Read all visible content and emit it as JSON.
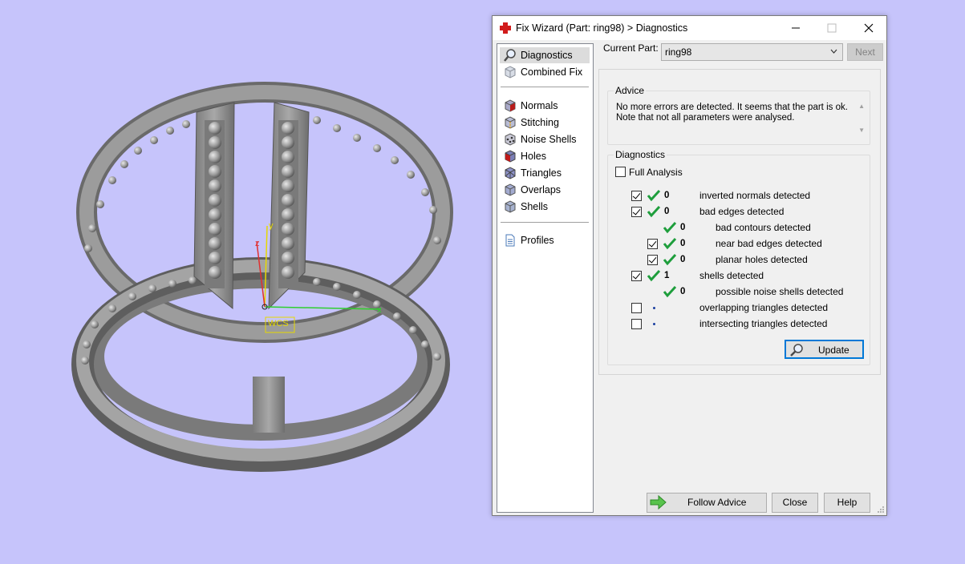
{
  "window": {
    "title": "Fix Wizard (Part: ring98) > Diagnostics"
  },
  "viewport": {
    "axis_x": "x",
    "axis_y": "y",
    "axis_z": "z",
    "wcs_label": "WCS"
  },
  "sidebar": {
    "items": [
      {
        "label": "Diagnostics",
        "icon": "magnifier-icon"
      },
      {
        "label": "Combined Fix",
        "icon": "combined-fix-icon"
      },
      {
        "label": "Normals",
        "icon": "normals-cube-icon"
      },
      {
        "label": "Stitching",
        "icon": "stitching-cube-icon"
      },
      {
        "label": "Noise Shells",
        "icon": "noise-shells-icon"
      },
      {
        "label": "Holes",
        "icon": "holes-cube-icon"
      },
      {
        "label": "Triangles",
        "icon": "triangles-cube-icon"
      },
      {
        "label": "Overlaps",
        "icon": "overlaps-cube-icon"
      },
      {
        "label": "Shells",
        "icon": "shells-cube-icon"
      },
      {
        "label": "Profiles",
        "icon": "document-icon"
      }
    ]
  },
  "current_part": {
    "label": "Current Part:",
    "value": "ring98",
    "next_label": "Next"
  },
  "advice": {
    "title": "Advice",
    "line1": "No more errors are detected. It seems that the part is ok.",
    "line2": "Note that not all parameters were analysed."
  },
  "diagnostics": {
    "title": "Diagnostics",
    "full_analysis_label": "Full Analysis",
    "rows": [
      {
        "checkbox": true,
        "checked": true,
        "status": "ok",
        "count": "0",
        "label": "inverted normals detected"
      },
      {
        "checkbox": true,
        "checked": true,
        "status": "ok",
        "count": "0",
        "label": "bad edges detected"
      },
      {
        "checkbox": false,
        "checked": false,
        "status": "ok",
        "count": "0",
        "label": "bad contours detected"
      },
      {
        "checkbox": true,
        "checked": true,
        "status": "ok",
        "count": "0",
        "label": "near bad edges detected"
      },
      {
        "checkbox": true,
        "checked": true,
        "status": "ok",
        "count": "0",
        "label": "planar holes detected"
      },
      {
        "checkbox": true,
        "checked": true,
        "status": "ok",
        "count": "1",
        "label": "shells detected"
      },
      {
        "checkbox": false,
        "checked": false,
        "status": "ok",
        "count": "0",
        "label": "possible noise shells detected"
      },
      {
        "checkbox": true,
        "checked": false,
        "status": "not-run",
        "count": "",
        "label": "overlapping triangles detected"
      },
      {
        "checkbox": true,
        "checked": false,
        "status": "not-run",
        "count": "",
        "label": "intersecting triangles detected"
      }
    ],
    "update_label": "Update"
  },
  "buttons": {
    "follow_advice": "Follow Advice",
    "close": "Close",
    "help": "Help"
  },
  "colors": {
    "background": "#c6c4fb",
    "check_green": "#1e9e3c",
    "accent_blue": "#0078d7"
  }
}
